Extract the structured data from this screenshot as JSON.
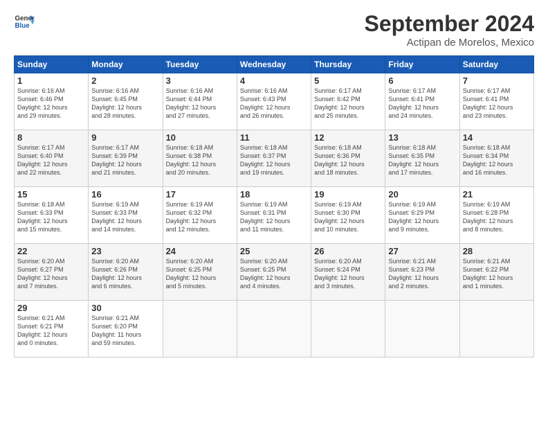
{
  "logo": {
    "line1": "General",
    "line2": "Blue"
  },
  "title": "September 2024",
  "subtitle": "Actipan de Morelos, Mexico",
  "headers": [
    "Sunday",
    "Monday",
    "Tuesday",
    "Wednesday",
    "Thursday",
    "Friday",
    "Saturday"
  ],
  "weeks": [
    [
      {
        "day": "1",
        "rise": "6:16 AM",
        "set": "6:46 PM",
        "hours": "12",
        "mins": "29"
      },
      {
        "day": "2",
        "rise": "6:16 AM",
        "set": "6:45 PM",
        "hours": "12",
        "mins": "28"
      },
      {
        "day": "3",
        "rise": "6:16 AM",
        "set": "6:44 PM",
        "hours": "12",
        "mins": "27"
      },
      {
        "day": "4",
        "rise": "6:16 AM",
        "set": "6:43 PM",
        "hours": "12",
        "mins": "26"
      },
      {
        "day": "5",
        "rise": "6:17 AM",
        "set": "6:42 PM",
        "hours": "12",
        "mins": "25"
      },
      {
        "day": "6",
        "rise": "6:17 AM",
        "set": "6:41 PM",
        "hours": "12",
        "mins": "24"
      },
      {
        "day": "7",
        "rise": "6:17 AM",
        "set": "6:41 PM",
        "hours": "12",
        "mins": "23"
      }
    ],
    [
      {
        "day": "8",
        "rise": "6:17 AM",
        "set": "6:40 PM",
        "hours": "12",
        "mins": "22"
      },
      {
        "day": "9",
        "rise": "6:17 AM",
        "set": "6:39 PM",
        "hours": "12",
        "mins": "21"
      },
      {
        "day": "10",
        "rise": "6:18 AM",
        "set": "6:38 PM",
        "hours": "12",
        "mins": "20"
      },
      {
        "day": "11",
        "rise": "6:18 AM",
        "set": "6:37 PM",
        "hours": "12",
        "mins": "19"
      },
      {
        "day": "12",
        "rise": "6:18 AM",
        "set": "6:36 PM",
        "hours": "12",
        "mins": "18"
      },
      {
        "day": "13",
        "rise": "6:18 AM",
        "set": "6:35 PM",
        "hours": "12",
        "mins": "17"
      },
      {
        "day": "14",
        "rise": "6:18 AM",
        "set": "6:34 PM",
        "hours": "12",
        "mins": "16"
      }
    ],
    [
      {
        "day": "15",
        "rise": "6:18 AM",
        "set": "6:33 PM",
        "hours": "12",
        "mins": "15"
      },
      {
        "day": "16",
        "rise": "6:19 AM",
        "set": "6:33 PM",
        "hours": "12",
        "mins": "14"
      },
      {
        "day": "17",
        "rise": "6:19 AM",
        "set": "6:32 PM",
        "hours": "12",
        "mins": "12"
      },
      {
        "day": "18",
        "rise": "6:19 AM",
        "set": "6:31 PM",
        "hours": "12",
        "mins": "11"
      },
      {
        "day": "19",
        "rise": "6:19 AM",
        "set": "6:30 PM",
        "hours": "12",
        "mins": "10"
      },
      {
        "day": "20",
        "rise": "6:19 AM",
        "set": "6:29 PM",
        "hours": "12",
        "mins": "9"
      },
      {
        "day": "21",
        "rise": "6:19 AM",
        "set": "6:28 PM",
        "hours": "12",
        "mins": "8"
      }
    ],
    [
      {
        "day": "22",
        "rise": "6:20 AM",
        "set": "6:27 PM",
        "hours": "12",
        "mins": "7"
      },
      {
        "day": "23",
        "rise": "6:20 AM",
        "set": "6:26 PM",
        "hours": "12",
        "mins": "6"
      },
      {
        "day": "24",
        "rise": "6:20 AM",
        "set": "6:25 PM",
        "hours": "12",
        "mins": "5"
      },
      {
        "day": "25",
        "rise": "6:20 AM",
        "set": "6:25 PM",
        "hours": "12",
        "mins": "4"
      },
      {
        "day": "26",
        "rise": "6:20 AM",
        "set": "6:24 PM",
        "hours": "12",
        "mins": "3"
      },
      {
        "day": "27",
        "rise": "6:21 AM",
        "set": "6:23 PM",
        "hours": "12",
        "mins": "2"
      },
      {
        "day": "28",
        "rise": "6:21 AM",
        "set": "6:22 PM",
        "hours": "12",
        "mins": "1"
      }
    ],
    [
      {
        "day": "29",
        "rise": "6:21 AM",
        "set": "6:21 PM",
        "hours": "12",
        "mins": "0"
      },
      {
        "day": "30",
        "rise": "6:21 AM",
        "set": "6:20 PM",
        "hours": "11",
        "mins": "59"
      },
      null,
      null,
      null,
      null,
      null
    ]
  ]
}
